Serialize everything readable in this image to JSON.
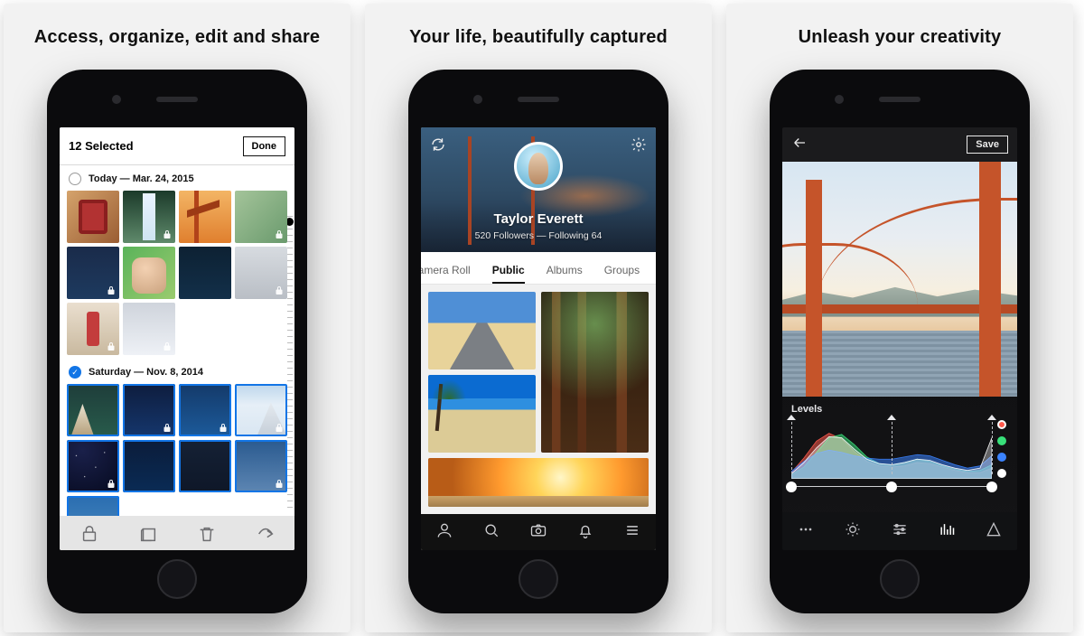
{
  "panels": [
    {
      "headline": "Access, organize, edit and share"
    },
    {
      "headline": "Your life, beautifully captured"
    },
    {
      "headline": "Unleash your creativity"
    }
  ],
  "screen1": {
    "title": "12 Selected",
    "done_label": "Done",
    "groups": [
      {
        "label": "Today — Mar. 24, 2015",
        "selected": false
      },
      {
        "label": "Saturday — Nov. 8, 2014",
        "selected": true
      }
    ],
    "tabbar_icons": [
      "privacy-icon",
      "albums-icon",
      "trash-icon",
      "share-icon"
    ]
  },
  "screen2": {
    "profile_name": "Taylor Everett",
    "profile_sub": "520 Followers — Following 64",
    "tabs": [
      "Camera Roll",
      "Public",
      "Albums",
      "Groups"
    ],
    "active_tab": "Public",
    "nav_icons": [
      "profile-icon",
      "search-icon",
      "camera-icon",
      "notifications-icon",
      "menu-icon"
    ]
  },
  "screen3": {
    "save_label": "Save",
    "levels_label": "Levels",
    "legend": [
      "red",
      "green",
      "blue",
      "luma"
    ],
    "tool_icons": [
      "more-icon",
      "brightness-icon",
      "sliders-icon",
      "levels-icon",
      "sharpen-icon"
    ]
  },
  "chart_data": {
    "type": "area",
    "title": "Levels",
    "xlabel": "",
    "ylabel": "",
    "xlim": [
      0,
      255
    ],
    "ylim": [
      0,
      100
    ],
    "x": [
      0,
      16,
      32,
      48,
      64,
      80,
      96,
      112,
      128,
      144,
      160,
      176,
      192,
      208,
      224,
      240,
      255
    ],
    "series": [
      {
        "name": "red",
        "color": "#ff5a4d",
        "values": [
          10,
          36,
          66,
          80,
          70,
          48,
          30,
          22,
          20,
          22,
          28,
          26,
          20,
          14,
          10,
          10,
          18
        ]
      },
      {
        "name": "green",
        "color": "#38e07a",
        "values": [
          6,
          20,
          46,
          72,
          78,
          60,
          38,
          26,
          24,
          28,
          34,
          30,
          22,
          16,
          12,
          14,
          24
        ]
      },
      {
        "name": "blue",
        "color": "#3b83ff",
        "values": [
          12,
          30,
          44,
          50,
          46,
          40,
          36,
          34,
          34,
          38,
          42,
          40,
          32,
          24,
          18,
          22,
          40
        ]
      },
      {
        "name": "luma",
        "color": "#ffffff",
        "values": [
          8,
          28,
          54,
          74,
          72,
          52,
          34,
          26,
          24,
          28,
          34,
          32,
          24,
          18,
          14,
          18,
          72
        ]
      }
    ],
    "handles_x": [
      0,
      128,
      255
    ]
  }
}
